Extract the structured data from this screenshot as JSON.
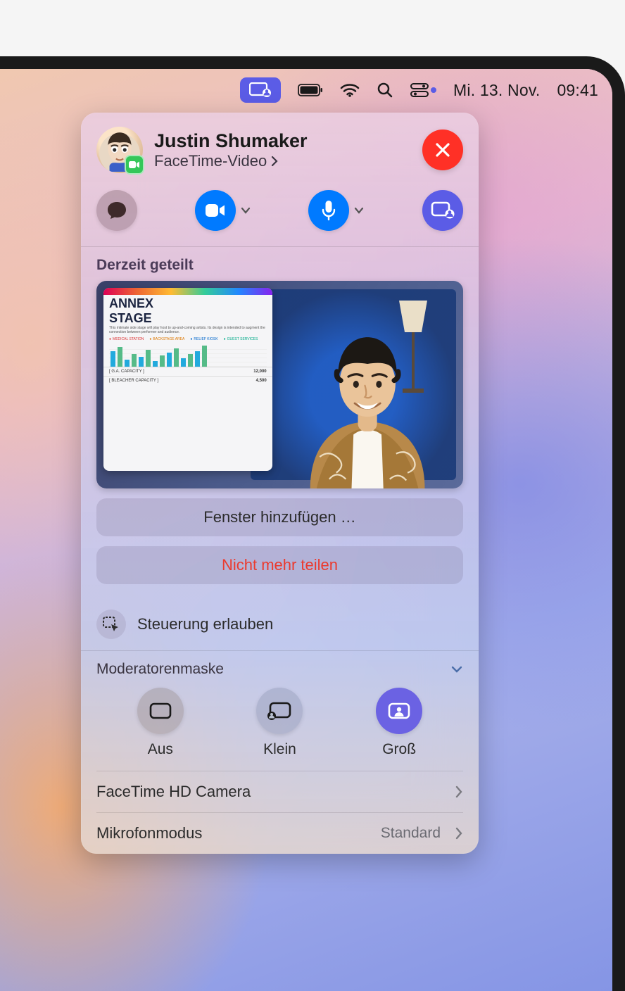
{
  "menubar": {
    "date": "Mi. 13. Nov.",
    "time": "09:41"
  },
  "header": {
    "name": "Justin Shumaker",
    "subtitle": "FaceTime-Video"
  },
  "sharing": {
    "title": "Derzeit geteilt",
    "add_window_label": "Fenster hinzufügen …",
    "stop_sharing_label": "Nicht mehr teilen",
    "allow_control_label": "Steuerung erlauben"
  },
  "preview_window": {
    "title_line1": "ANNEX",
    "title_line2": "STAGE",
    "legend": {
      "medical": "MEDICAL STATION",
      "backstage": "BACKSTAGE AREA",
      "relief": "RELIEF KIOSK",
      "guest": "GUEST SERVICES"
    },
    "rows": {
      "ga_label": "G.A. CAPACITY",
      "ga_value": "12,000",
      "bleacher_label": "BLEACHER CAPACITY",
      "bleacher_value": "4,500"
    }
  },
  "presenter_mask": {
    "title": "Moderatorenmaske",
    "options": {
      "off": "Aus",
      "small": "Klein",
      "large": "Groß"
    }
  },
  "settings": {
    "camera_label": "FaceTime HD Camera",
    "mic_mode_label": "Mikrofonmodus",
    "mic_mode_value": "Standard"
  },
  "colors": {
    "blue": "#007aff",
    "purple": "#5b5ce6",
    "red": "#ff3026",
    "danger_text": "#eb3a2e",
    "green": "#34c759"
  }
}
